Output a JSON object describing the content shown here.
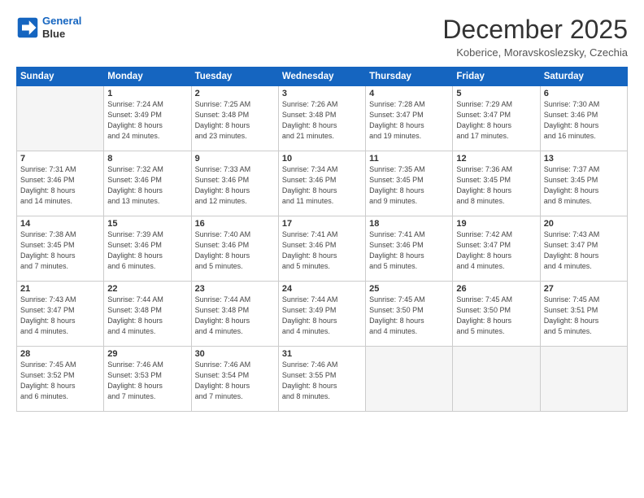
{
  "header": {
    "logo_line1": "General",
    "logo_line2": "Blue",
    "month": "December 2025",
    "location": "Koberice, Moravskoslezsky, Czechia"
  },
  "weekdays": [
    "Sunday",
    "Monday",
    "Tuesday",
    "Wednesday",
    "Thursday",
    "Friday",
    "Saturday"
  ],
  "weeks": [
    [
      {
        "day": "",
        "info": ""
      },
      {
        "day": "1",
        "info": "Sunrise: 7:24 AM\nSunset: 3:49 PM\nDaylight: 8 hours\nand 24 minutes."
      },
      {
        "day": "2",
        "info": "Sunrise: 7:25 AM\nSunset: 3:48 PM\nDaylight: 8 hours\nand 23 minutes."
      },
      {
        "day": "3",
        "info": "Sunrise: 7:26 AM\nSunset: 3:48 PM\nDaylight: 8 hours\nand 21 minutes."
      },
      {
        "day": "4",
        "info": "Sunrise: 7:28 AM\nSunset: 3:47 PM\nDaylight: 8 hours\nand 19 minutes."
      },
      {
        "day": "5",
        "info": "Sunrise: 7:29 AM\nSunset: 3:47 PM\nDaylight: 8 hours\nand 17 minutes."
      },
      {
        "day": "6",
        "info": "Sunrise: 7:30 AM\nSunset: 3:46 PM\nDaylight: 8 hours\nand 16 minutes."
      }
    ],
    [
      {
        "day": "7",
        "info": "Sunrise: 7:31 AM\nSunset: 3:46 PM\nDaylight: 8 hours\nand 14 minutes."
      },
      {
        "day": "8",
        "info": "Sunrise: 7:32 AM\nSunset: 3:46 PM\nDaylight: 8 hours\nand 13 minutes."
      },
      {
        "day": "9",
        "info": "Sunrise: 7:33 AM\nSunset: 3:46 PM\nDaylight: 8 hours\nand 12 minutes."
      },
      {
        "day": "10",
        "info": "Sunrise: 7:34 AM\nSunset: 3:46 PM\nDaylight: 8 hours\nand 11 minutes."
      },
      {
        "day": "11",
        "info": "Sunrise: 7:35 AM\nSunset: 3:45 PM\nDaylight: 8 hours\nand 9 minutes."
      },
      {
        "day": "12",
        "info": "Sunrise: 7:36 AM\nSunset: 3:45 PM\nDaylight: 8 hours\nand 8 minutes."
      },
      {
        "day": "13",
        "info": "Sunrise: 7:37 AM\nSunset: 3:45 PM\nDaylight: 8 hours\nand 8 minutes."
      }
    ],
    [
      {
        "day": "14",
        "info": "Sunrise: 7:38 AM\nSunset: 3:45 PM\nDaylight: 8 hours\nand 7 minutes."
      },
      {
        "day": "15",
        "info": "Sunrise: 7:39 AM\nSunset: 3:46 PM\nDaylight: 8 hours\nand 6 minutes."
      },
      {
        "day": "16",
        "info": "Sunrise: 7:40 AM\nSunset: 3:46 PM\nDaylight: 8 hours\nand 5 minutes."
      },
      {
        "day": "17",
        "info": "Sunrise: 7:41 AM\nSunset: 3:46 PM\nDaylight: 8 hours\nand 5 minutes."
      },
      {
        "day": "18",
        "info": "Sunrise: 7:41 AM\nSunset: 3:46 PM\nDaylight: 8 hours\nand 5 minutes."
      },
      {
        "day": "19",
        "info": "Sunrise: 7:42 AM\nSunset: 3:47 PM\nDaylight: 8 hours\nand 4 minutes."
      },
      {
        "day": "20",
        "info": "Sunrise: 7:43 AM\nSunset: 3:47 PM\nDaylight: 8 hours\nand 4 minutes."
      }
    ],
    [
      {
        "day": "21",
        "info": "Sunrise: 7:43 AM\nSunset: 3:47 PM\nDaylight: 8 hours\nand 4 minutes."
      },
      {
        "day": "22",
        "info": "Sunrise: 7:44 AM\nSunset: 3:48 PM\nDaylight: 8 hours\nand 4 minutes."
      },
      {
        "day": "23",
        "info": "Sunrise: 7:44 AM\nSunset: 3:48 PM\nDaylight: 8 hours\nand 4 minutes."
      },
      {
        "day": "24",
        "info": "Sunrise: 7:44 AM\nSunset: 3:49 PM\nDaylight: 8 hours\nand 4 minutes."
      },
      {
        "day": "25",
        "info": "Sunrise: 7:45 AM\nSunset: 3:50 PM\nDaylight: 8 hours\nand 4 minutes."
      },
      {
        "day": "26",
        "info": "Sunrise: 7:45 AM\nSunset: 3:50 PM\nDaylight: 8 hours\nand 5 minutes."
      },
      {
        "day": "27",
        "info": "Sunrise: 7:45 AM\nSunset: 3:51 PM\nDaylight: 8 hours\nand 5 minutes."
      }
    ],
    [
      {
        "day": "28",
        "info": "Sunrise: 7:45 AM\nSunset: 3:52 PM\nDaylight: 8 hours\nand 6 minutes."
      },
      {
        "day": "29",
        "info": "Sunrise: 7:46 AM\nSunset: 3:53 PM\nDaylight: 8 hours\nand 7 minutes."
      },
      {
        "day": "30",
        "info": "Sunrise: 7:46 AM\nSunset: 3:54 PM\nDaylight: 8 hours\nand 7 minutes."
      },
      {
        "day": "31",
        "info": "Sunrise: 7:46 AM\nSunset: 3:55 PM\nDaylight: 8 hours\nand 8 minutes."
      },
      {
        "day": "",
        "info": ""
      },
      {
        "day": "",
        "info": ""
      },
      {
        "day": "",
        "info": ""
      }
    ]
  ]
}
